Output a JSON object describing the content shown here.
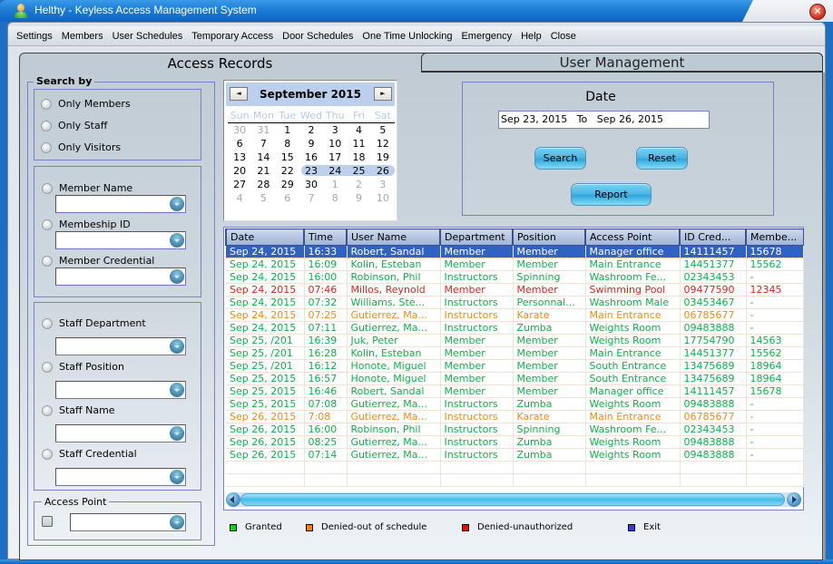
{
  "window": {
    "title": "Helthy - Keyless Access Management System",
    "close_glyph": "✕"
  },
  "menu": [
    "Settings",
    "Members",
    "User Schedules",
    "Temporary Access",
    "Door Schedules",
    "One Time Unlocking",
    "Emergency",
    "Help",
    "Close"
  ],
  "tabs": {
    "active": "Access Records",
    "inactive": "User Management"
  },
  "search_by": {
    "legend": "Search by",
    "scope_options": [
      "Only Members",
      "Only Staff",
      "Only Visitors"
    ],
    "member_filters": [
      {
        "label": "Member Name",
        "value": ""
      },
      {
        "label": "Membeship ID",
        "value": ""
      },
      {
        "label": "Member Credential",
        "value": ""
      }
    ],
    "staff_filters": [
      {
        "label": "Staff Department",
        "value": ""
      },
      {
        "label": "Staff Position",
        "value": ""
      },
      {
        "label": "Staff Name",
        "value": ""
      },
      {
        "label": "Staff Credential",
        "value": ""
      }
    ],
    "access_point": {
      "legend": "Access Point",
      "value": "",
      "checked": false
    }
  },
  "calendar": {
    "title": "September 2015",
    "prev_glyph": "◄",
    "next_glyph": "►",
    "days_of_week": [
      "Sun",
      "Mon",
      "Tue",
      "Wed",
      "Thu",
      "Fri",
      "Sat"
    ],
    "weeks": [
      [
        {
          "d": "30",
          "o": true
        },
        {
          "d": "31",
          "o": true
        },
        {
          "d": "1"
        },
        {
          "d": "2"
        },
        {
          "d": "3"
        },
        {
          "d": "4"
        },
        {
          "d": "5"
        }
      ],
      [
        {
          "d": "6"
        },
        {
          "d": "7"
        },
        {
          "d": "8"
        },
        {
          "d": "9"
        },
        {
          "d": "10"
        },
        {
          "d": "11"
        },
        {
          "d": "12"
        }
      ],
      [
        {
          "d": "13"
        },
        {
          "d": "14"
        },
        {
          "d": "15"
        },
        {
          "d": "16"
        },
        {
          "d": "17"
        },
        {
          "d": "18"
        },
        {
          "d": "19"
        }
      ],
      [
        {
          "d": "20"
        },
        {
          "d": "21"
        },
        {
          "d": "22"
        },
        {
          "d": "23"
        },
        {
          "d": "24"
        },
        {
          "d": "25"
        },
        {
          "d": "26"
        }
      ],
      [
        {
          "d": "27"
        },
        {
          "d": "28"
        },
        {
          "d": "29"
        },
        {
          "d": "30"
        },
        {
          "d": "1",
          "o": true
        },
        {
          "d": "2",
          "o": true
        },
        {
          "d": "3",
          "o": true
        }
      ],
      [
        {
          "d": "4",
          "o": true
        },
        {
          "d": "5",
          "o": true
        },
        {
          "d": "6",
          "o": true
        },
        {
          "d": "7",
          "o": true
        },
        {
          "d": "8",
          "o": true
        },
        {
          "d": "9",
          "o": true
        },
        {
          "d": "10",
          "o": true
        }
      ]
    ],
    "selected_range": {
      "start": "23",
      "end": "26"
    }
  },
  "date_filter": {
    "label": "Date",
    "value": "Sep 23, 2015   To   Sep 26, 2015",
    "search_button": "Search",
    "reset_button": "Reset",
    "report_button": "Report"
  },
  "records": {
    "columns": [
      "Date",
      "Time",
      "User Name",
      "Department",
      "Position",
      "Access Point",
      "ID Cred...",
      "Membe..."
    ],
    "selected_index": 0,
    "rows": [
      {
        "status": "granted",
        "cells": [
          "Sep 24, 2015",
          "16:33",
          "Robert, Sandal",
          "Member",
          "Member",
          "Manager office",
          "14111457",
          "15678"
        ]
      },
      {
        "status": "granted",
        "cells": [
          "Sep 24, 2015",
          "16:09",
          "Kolin, Esteban",
          "Member",
          "Member",
          "Main Entrance",
          "14451377",
          "15562"
        ]
      },
      {
        "status": "granted",
        "cells": [
          "Sep 24, 2015",
          "16:00",
          "Robinson, Phil",
          "Instructors",
          "Spinning",
          "Washroom Fe...",
          "02343453",
          "-"
        ]
      },
      {
        "status": "denied-unauth",
        "cells": [
          "Sep 24, 2015",
          "07:46",
          "Millos, Reynold",
          "Member",
          "Member",
          "Swimming Pool",
          "09477590",
          "12345"
        ]
      },
      {
        "status": "granted",
        "cells": [
          "Sep 24, 2015",
          "07:32",
          "Williams, Ste...",
          "Instructors",
          "Personnal...",
          "Washroom Male",
          "03453467",
          "-"
        ]
      },
      {
        "status": "denied-schedule",
        "cells": [
          "Sep 24, 2015",
          "07:25",
          "Gutierrez, Ma...",
          "Instructors",
          "Karate",
          "Main Entrance",
          "06785677",
          "-"
        ]
      },
      {
        "status": "granted",
        "cells": [
          "Sep 24, 2015",
          "07:11",
          "Gutierrez, Ma...",
          "Instructors",
          "Zumba",
          "Weights Room",
          "09483888",
          "-"
        ]
      },
      {
        "status": "granted",
        "cells": [
          "Sep 25, /201",
          "16:39",
          "Juk, Peter",
          "Member",
          "Member",
          "Weights Room",
          "17754790",
          "14563"
        ]
      },
      {
        "status": "granted",
        "cells": [
          "Sep 25, /201",
          "16:28",
          "Kolin, Esteban",
          "Member",
          "Member",
          "Main Entrance",
          "14451377",
          "15562"
        ]
      },
      {
        "status": "granted",
        "cells": [
          "Sep 25, /201",
          "16:12",
          "Honote, Miguel",
          "Member",
          "Member",
          "South Entrance",
          "13475689",
          "18964"
        ]
      },
      {
        "status": "granted",
        "cells": [
          "Sep 25, 2015",
          "16:57",
          "Honote, Miguel",
          "Member",
          "Member",
          "South Entrance",
          "13475689",
          "18964"
        ]
      },
      {
        "status": "granted",
        "cells": [
          "Sep 25, 2015",
          "16:46",
          "Robert, Sandal",
          "Member",
          "Member",
          "Manager office",
          "14111457",
          "15678"
        ]
      },
      {
        "status": "granted",
        "cells": [
          "Sep 25, 2015",
          "07:08",
          "Gutierrez, Ma...",
          "Instructors",
          "Zumba",
          "Weights Room",
          "09483888",
          "-"
        ]
      },
      {
        "status": "denied-schedule",
        "cells": [
          "Sep 26, 2015",
          "7:08",
          "Gutierrez, Ma...",
          "Instructors",
          "Karate",
          "Main Entrance",
          "06785677",
          "-"
        ]
      },
      {
        "status": "granted",
        "cells": [
          "Sep 26, 2015",
          "16:00",
          "Robinson, Phil",
          "Instructors",
          "Spinning",
          "Washroom Fe...",
          "02343453",
          "-"
        ]
      },
      {
        "status": "granted",
        "cells": [
          "Sep 26, 2015",
          "08:25",
          "Gutierrez, Ma...",
          "Instructors",
          "Zumba",
          "Weights Room",
          "09483888",
          "-"
        ]
      },
      {
        "status": "granted",
        "cells": [
          "Sep 26, 2015",
          "07:14",
          "Gutierrez, Ma...",
          "Instructors",
          "Zumba",
          "Weights Room",
          "09483888",
          "-"
        ]
      }
    ],
    "empty_rows": 2
  },
  "legend": [
    {
      "key": "granted",
      "label": "Granted",
      "color": "#00e000"
    },
    {
      "key": "denied-schedule",
      "label": "Denied-out of schedule",
      "color": "#ff8000"
    },
    {
      "key": "denied-unauth",
      "label": "Denied-unauthorized",
      "color": "#ff0000"
    },
    {
      "key": "exit",
      "label": "Exit",
      "color": "#3030ff"
    }
  ],
  "status_colors": {
    "granted": "#11b04a",
    "denied-schedule": "#f08a12",
    "denied-unauth": "#e0241c",
    "exit": "#2a2ae0",
    "selected_row_bg": "#3062c4"
  }
}
